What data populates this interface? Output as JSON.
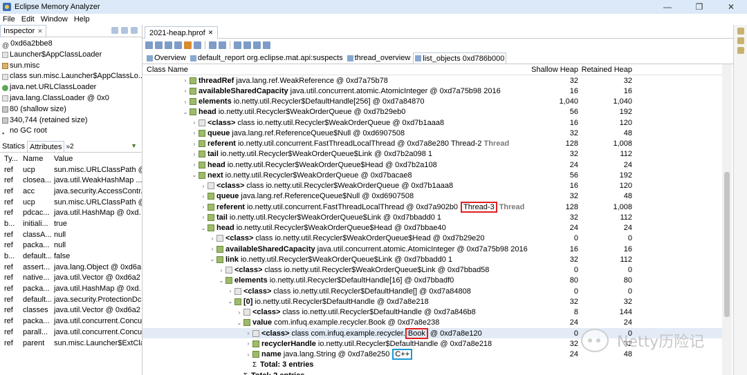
{
  "window": {
    "title": "Eclipse Memory Analyzer",
    "min": "—",
    "restore": "❐",
    "close": "✕"
  },
  "menu": [
    "File",
    "Edit",
    "Window",
    "Help"
  ],
  "inspector": {
    "tab_label": "Inspector",
    "lines": [
      {
        "icon": "at",
        "text": "0xd6a2bbe8"
      },
      {
        "icon": "cls",
        "text": "Launcher$AppClassLoader"
      },
      {
        "icon": "pkg",
        "text": "sun.misc"
      },
      {
        "icon": "cls",
        "text": "class sun.misc.Launcher$AppClassLo..."
      },
      {
        "icon": "obj",
        "text": "java.net.URLClassLoader"
      },
      {
        "icon": "cls",
        "text": "java.lang.ClassLoader @ 0x0"
      },
      {
        "icon": "size",
        "text": "80 (shallow size)"
      },
      {
        "icon": "size",
        "text": "340,744 (retained size)"
      },
      {
        "icon": "gc",
        "text": "no GC root"
      }
    ]
  },
  "attr_tabs": {
    "statics": "Statics",
    "attributes": "Attributes",
    "more": "»2"
  },
  "attr_table": {
    "headers": [
      "Ty...",
      "Name",
      "Value"
    ],
    "rows": [
      [
        "ref",
        "ucp",
        "sun.misc.URLClassPath @"
      ],
      [
        "ref",
        "closea...",
        "java.util.WeakHashMap ..."
      ],
      [
        "ref",
        "acc",
        "java.security.AccessContr..."
      ],
      [
        "ref",
        "ucp",
        "sun.misc.URLClassPath @"
      ],
      [
        "ref",
        "pdcac...",
        "java.util.HashMap @ 0xd."
      ],
      [
        "b...",
        "initiali...",
        "true"
      ],
      [
        "ref",
        "classA...",
        "null"
      ],
      [
        "ref",
        "packa...",
        "null"
      ],
      [
        "b...",
        "default...",
        "false"
      ],
      [
        "ref",
        "assert...",
        "java.lang.Object @ 0xd6a"
      ],
      [
        "ref",
        "native...",
        "java.util.Vector @ 0xd6a2"
      ],
      [
        "ref",
        "packa...",
        "java.util.HashMap @ 0xd."
      ],
      [
        "ref",
        "default...",
        "java.security.ProtectionDc"
      ],
      [
        "ref",
        "classes",
        "java.util.Vector @ 0xd6a2"
      ],
      [
        "ref",
        "packa...",
        "java.util.concurrent.Concu"
      ],
      [
        "ref",
        "parall...",
        "java.util.concurrent.Concu"
      ],
      [
        "ref",
        "parent",
        "sun.misc.Launcher$ExtCla"
      ]
    ]
  },
  "editor_tab": "2021-heap.hprof",
  "subtabs": [
    "Overview",
    "default_report  org.eclipse.mat.api:suspects",
    "thread_overview",
    "list_objects  0xd786b000"
  ],
  "grid": {
    "headers": {
      "name": "Class Name",
      "shallow": "Shallow Heap",
      "retained": "Retained Heap"
    },
    "rows": [
      {
        "ind": 0,
        "tw": "›",
        "ic": "f",
        "bold": "threadRef",
        "rest": "java.lang.ref.WeakReference @ 0xd7a75b78",
        "s": "32",
        "r": "32"
      },
      {
        "ind": 0,
        "tw": "›",
        "ic": "f",
        "bold": "availableSharedCapacity",
        "rest": "java.util.concurrent.atomic.AtomicInteger @ 0xd7a75b98  2016",
        "s": "16",
        "r": "16"
      },
      {
        "ind": 0,
        "tw": "›",
        "ic": "f",
        "bold": "elements",
        "rest": "io.netty.util.Recycler$DefaultHandle[256] @ 0xd7a84870",
        "s": "1,040",
        "r": "1,040"
      },
      {
        "ind": 0,
        "tw": "⌄",
        "ic": "f",
        "bold": "head",
        "rest": "io.netty.util.Recycler$WeakOrderQueue @ 0xd7b29eb0",
        "s": "56",
        "r": "192"
      },
      {
        "ind": 1,
        "tw": "›",
        "ic": "c",
        "bold": "<class>",
        "rest": "class io.netty.util.Recycler$WeakOrderQueue @ 0xd7b1aaa8",
        "s": "16",
        "r": "120"
      },
      {
        "ind": 1,
        "tw": "›",
        "ic": "f",
        "bold": "queue",
        "rest": "java.lang.ref.ReferenceQueue$Null @ 0xd6907508",
        "s": "32",
        "r": "48"
      },
      {
        "ind": 1,
        "tw": "›",
        "ic": "f",
        "bold": "referent",
        "rest": "io.netty.util.concurrent.FastThreadLocalThread @ 0xd7a8e280  Thread-2",
        "gray": "Thread",
        "s": "128",
        "r": "1,008"
      },
      {
        "ind": 1,
        "tw": "›",
        "ic": "f",
        "bold": "tail",
        "rest": "io.netty.util.Recycler$WeakOrderQueue$Link @ 0xd7b2a098  1",
        "s": "32",
        "r": "112"
      },
      {
        "ind": 1,
        "tw": "›",
        "ic": "f",
        "bold": "head",
        "rest": "io.netty.util.Recycler$WeakOrderQueue$Head @ 0xd7b2a108",
        "s": "24",
        "r": "24"
      },
      {
        "ind": 1,
        "tw": "⌄",
        "ic": "f",
        "bold": "next",
        "rest": "io.netty.util.Recycler$WeakOrderQueue @ 0xd7bacae8",
        "s": "56",
        "r": "192"
      },
      {
        "ind": 2,
        "tw": "›",
        "ic": "c",
        "bold": "<class>",
        "rest": "class io.netty.util.Recycler$WeakOrderQueue @ 0xd7b1aaa8",
        "s": "16",
        "r": "120"
      },
      {
        "ind": 2,
        "tw": "›",
        "ic": "f",
        "bold": "queue",
        "rest": "java.lang.ref.ReferenceQueue$Null @ 0xd6907508",
        "s": "32",
        "r": "48"
      },
      {
        "ind": 2,
        "tw": "›",
        "ic": "f",
        "bold": "referent",
        "rest": "io.netty.util.concurrent.FastThreadLocalThread @ 0xd7a902b0",
        "boxred": "Thread-3",
        "gray": "Thread",
        "s": "128",
        "r": "1,008"
      },
      {
        "ind": 2,
        "tw": "›",
        "ic": "f",
        "bold": "tail",
        "rest": "io.netty.util.Recycler$WeakOrderQueue$Link @ 0xd7bbadd0  1",
        "s": "32",
        "r": "112"
      },
      {
        "ind": 2,
        "tw": "⌄",
        "ic": "f",
        "bold": "head",
        "rest": "io.netty.util.Recycler$WeakOrderQueue$Head @ 0xd7bbae40",
        "s": "24",
        "r": "24"
      },
      {
        "ind": 3,
        "tw": "›",
        "ic": "c",
        "bold": "<class>",
        "rest": "class io.netty.util.Recycler$WeakOrderQueue$Head @ 0xd7b29e20",
        "s": "0",
        "r": "0"
      },
      {
        "ind": 3,
        "tw": "›",
        "ic": "f",
        "bold": "availableSharedCapacity",
        "rest": "java.util.concurrent.atomic.AtomicInteger @ 0xd7a75b98  2016",
        "s": "16",
        "r": "16"
      },
      {
        "ind": 3,
        "tw": "⌄",
        "ic": "f",
        "bold": "link",
        "rest": "io.netty.util.Recycler$WeakOrderQueue$Link @ 0xd7bbadd0  1",
        "s": "32",
        "r": "112"
      },
      {
        "ind": 4,
        "tw": "›",
        "ic": "c",
        "bold": "<class>",
        "rest": "class io.netty.util.Recycler$WeakOrderQueue$Link @ 0xd7bbad58",
        "s": "0",
        "r": "0"
      },
      {
        "ind": 4,
        "tw": "⌄",
        "ic": "f",
        "bold": "elements",
        "rest": "io.netty.util.Recycler$DefaultHandle[16] @ 0xd7bbadf0",
        "s": "80",
        "r": "80"
      },
      {
        "ind": 5,
        "tw": "›",
        "ic": "c",
        "bold": "<class>",
        "rest": "class io.netty.util.Recycler$DefaultHandle[] @ 0xd7a84808",
        "s": "0",
        "r": "0"
      },
      {
        "ind": 5,
        "tw": "⌄",
        "ic": "f",
        "bold": "[0]",
        "rest": "io.netty.util.Recycler$DefaultHandle @ 0xd7a8e218",
        "s": "32",
        "r": "32"
      },
      {
        "ind": 6,
        "tw": "›",
        "ic": "c",
        "bold": "<class>",
        "rest": "class io.netty.util.Recycler$DefaultHandle @ 0xd7a846b8",
        "s": "8",
        "r": "144"
      },
      {
        "ind": 6,
        "tw": "⌄",
        "ic": "f",
        "bold": "value",
        "rest": "com.infuq.example.recycler.Book @ 0xd7a8e238",
        "s": "24",
        "r": "24"
      },
      {
        "ind": 7,
        "tw": "›",
        "ic": "c",
        "bold": "<class>",
        "rest": "class com.infuq.example.recycler.",
        "boxred": "Book",
        "rest2": "@ 0xd7a8e120",
        "s": "0",
        "r": "0",
        "selected": true
      },
      {
        "ind": 7,
        "tw": "›",
        "ic": "f",
        "bold": "recyclerHandle",
        "rest": "io.netty.util.Recycler$DefaultHandle @ 0xd7a8e218",
        "s": "32",
        "r": "32"
      },
      {
        "ind": 7,
        "tw": "›",
        "ic": "f",
        "bold": "name",
        "rest": "java.lang.String @ 0xd7a8e250",
        "boxblue": "C++",
        "s": "24",
        "r": "48"
      },
      {
        "ind": 7,
        "tw": "",
        "ic": "sum",
        "bold": "Total: 3 entries",
        "rest": "",
        "s": "",
        "r": ""
      },
      {
        "ind": 6,
        "tw": "",
        "ic": "sum",
        "bold": "Total: 2 entries",
        "rest": "",
        "s": "",
        "r": ""
      }
    ]
  },
  "watermark": "Netty历险记"
}
